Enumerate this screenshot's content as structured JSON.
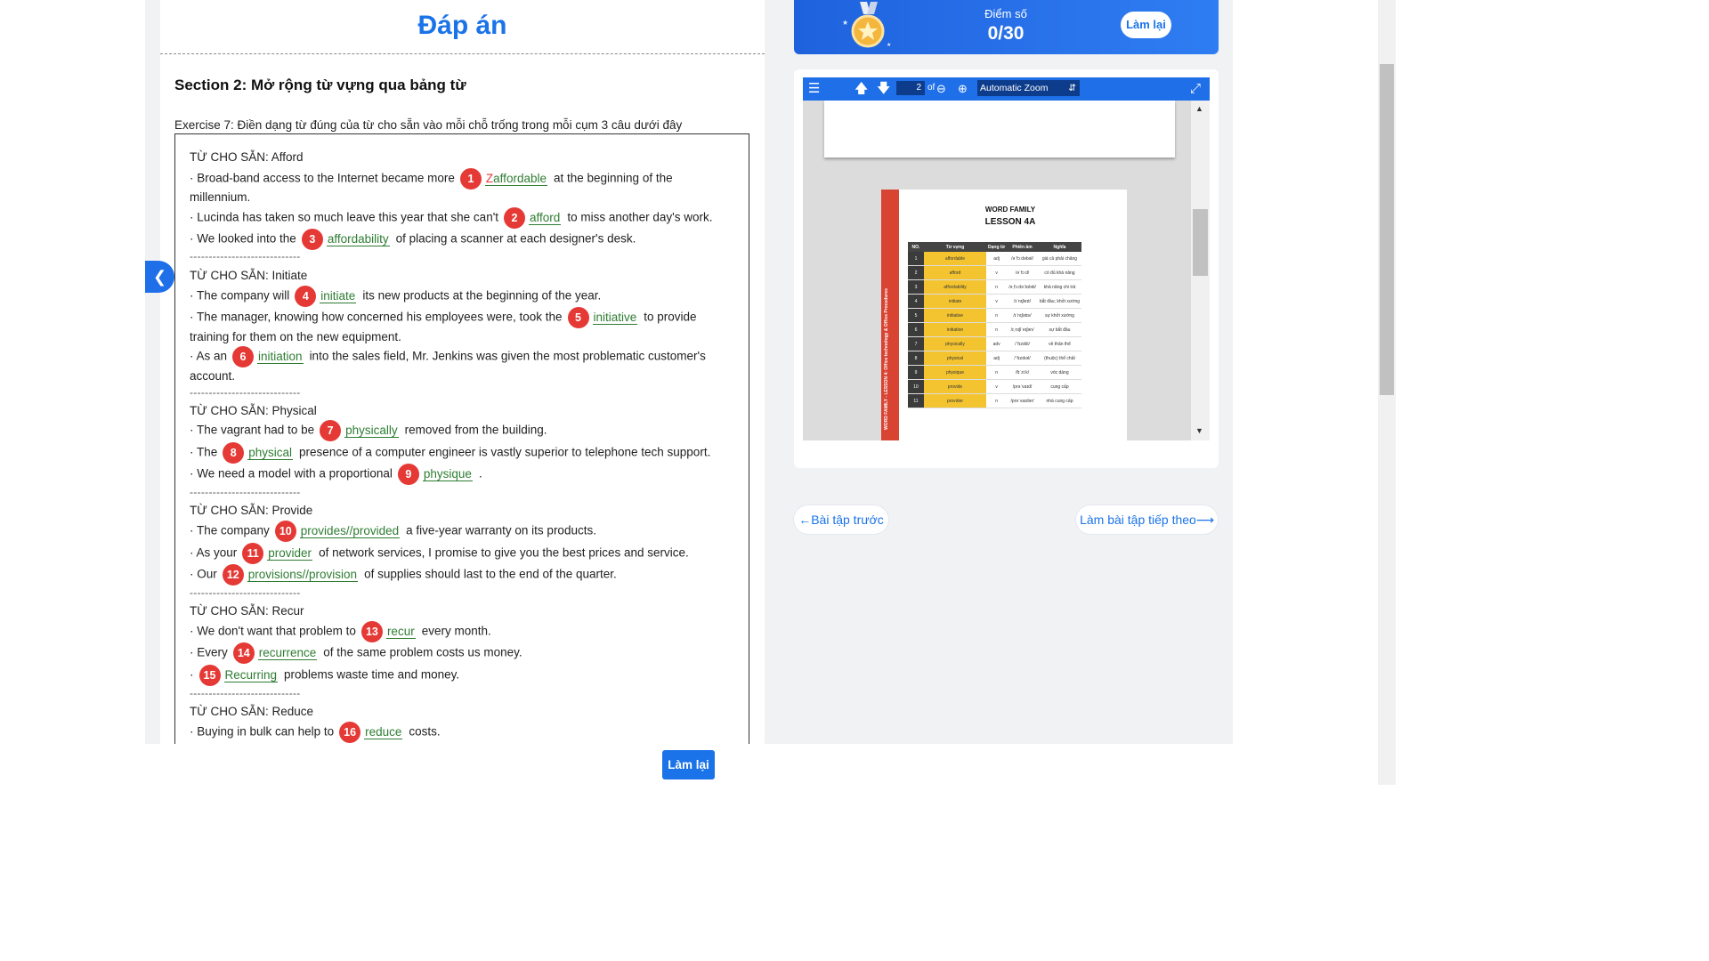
{
  "page_title": "Đáp án",
  "section_title": "Section 2: Mở rộng từ vựng qua bảng từ",
  "exercise_title": "Exercise 7: Điền dạng từ đúng của từ cho sẵn vào mỗi chỗ trống trong mỗi cụm 3 câu dưới đây",
  "separator": "-----------------------------",
  "groups": [
    {
      "label": "TỪ CHO SẴN: Afford"
    },
    {
      "label": "TỪ CHO SẴN: Initiate"
    },
    {
      "label": "TỪ CHO SẴN: Physical"
    },
    {
      "label": "TỪ CHO SẴN: Provide"
    },
    {
      "label": "TỪ CHO SẴN: Recur"
    },
    {
      "label": "TỪ CHO SẴN: Reduce"
    }
  ],
  "lines": [
    {
      "pre": "· Broad-band access to the Internet became more",
      "num": "1",
      "wrong": "Z",
      "answer": "affordable",
      "post": "at the beginning of the"
    },
    {
      "text": "millennium."
    },
    {
      "pre": "· Lucinda has taken so much leave this year that she can't",
      "num": "2",
      "answer": "afford",
      "post": "to miss another day's work."
    },
    {
      "pre": "· We looked into the",
      "num": "3",
      "answer": "affordability",
      "post": "of placing a scanner at each designer's desk."
    },
    {
      "pre": "· The company will",
      "num": "4",
      "answer": "initiate",
      "post": "its new products at the beginning of the year."
    },
    {
      "pre": "· The manager, knowing how concerned his employees were, took the",
      "num": "5",
      "answer": "initiative",
      "post": "to provide"
    },
    {
      "text": "training for them on the new equipment."
    },
    {
      "pre": "· As an",
      "num": "6",
      "answer": "initiation",
      "post": "into the sales field, Mr. Jenkins was given the most problematic customer's"
    },
    {
      "text": "account."
    },
    {
      "pre": "· The vagrant had to be",
      "num": "7",
      "answer": "physically",
      "post": "removed from the building."
    },
    {
      "pre": "· The",
      "num": "8",
      "answer": "physical",
      "post": "presence of a computer engineer is vastly superior to telephone tech support."
    },
    {
      "pre": "· We need a model with a proportional",
      "num": "9",
      "answer": "physique",
      "post": "."
    },
    {
      "pre": "· The company",
      "num": "10",
      "answer": "provides//provided",
      "post": "a five-year warranty on its products."
    },
    {
      "pre": "· As your",
      "num": "11",
      "answer": "provider",
      "post": "of network services, I promise to give you the best prices and service."
    },
    {
      "pre": "· Our",
      "num": "12",
      "answer": "provisions//provision",
      "post": "of supplies should last to the end of the quarter."
    },
    {
      "pre": "· We don't want that problem to",
      "num": "13",
      "answer": "recur",
      "post": "every month."
    },
    {
      "pre": "· Every",
      "num": "14",
      "answer": "recurrence",
      "post": "of the same problem costs us money."
    },
    {
      "pre": "·",
      "num": "15",
      "answer": "Recurring",
      "post": "problems waste time and money."
    },
    {
      "pre": "· Buying in bulk can help to",
      "num": "16",
      "answer": "reduce",
      "post": "costs."
    }
  ],
  "score": {
    "label": "Điểm số",
    "value": "0/30",
    "retry_label": "Làm lại"
  },
  "pdf_viewer": {
    "page_number": "2",
    "of_label": "of",
    "zoom": "Automatic Zoom",
    "doc_title_1": "WORD FAMILY",
    "doc_title_2": "LESSON 4A",
    "headers": [
      "NO.",
      "Từ vựng",
      "Dạng từ",
      "Phiên âm",
      "Nghĩa"
    ],
    "rows": [
      [
        "1",
        "affordable",
        "adj",
        "/əˈfɔːdəbəl/",
        "giá cả phải chăng"
      ],
      [
        "2",
        "afford",
        "v",
        "/əˈfɔːd/",
        "có đủ khả năng"
      ],
      [
        "3",
        "affordability",
        "n",
        "/əˌfɔːdəˈbɪləti/",
        "khả năng chi trả"
      ],
      [
        "4",
        "initiate",
        "v",
        "/ɪˈnɪʃieɪt/",
        "bắt đầu; khởi xướng"
      ],
      [
        "5",
        "initiative",
        "n",
        "/ɪˈnɪʃətɪv/",
        "sự khởi xướng"
      ],
      [
        "6",
        "initiation",
        "n",
        "/ɪˌnɪʃiˈeɪʃən/",
        "sự bắt đầu"
      ],
      [
        "7",
        "physically",
        "adv",
        "/ˈfɪzɪkli/",
        "về thân thể"
      ],
      [
        "8",
        "physical",
        "adj",
        "/ˈfɪzɪkəl/",
        "(thuộc) thể chất"
      ],
      [
        "9",
        "physique",
        "n",
        "/fɪˈziːk/",
        "vóc dáng"
      ],
      [
        "10",
        "provide",
        "v",
        "/prəˈvaɪd/",
        "cung cấp"
      ],
      [
        "11",
        "provider",
        "n",
        "/prəˈvaɪdər/",
        "nhà cung cấp"
      ]
    ],
    "side_text": "WORD FAMILY - LESSON 4: Office technology & Office Procedures"
  },
  "navigation": {
    "prev_label": "←Bài tập trước",
    "next_label": "Làm bài tập tiếp theo⟶"
  },
  "bottom": {
    "retry_label": "Làm lại"
  },
  "colors": {
    "accent": "#1a73e8",
    "badge": "#e53935",
    "answer": "#2e7d32"
  },
  "icons": [
    "chevron-left-icon",
    "medal-icon",
    "menu-icon",
    "arrow-up-icon",
    "arrow-down-icon",
    "zoom-out-icon",
    "zoom-in-icon",
    "fullscreen-icon"
  ]
}
